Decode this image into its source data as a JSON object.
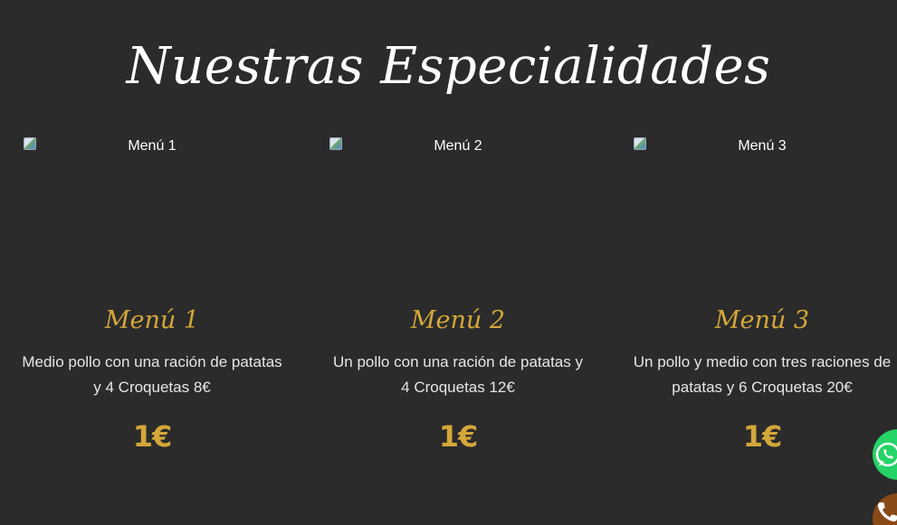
{
  "section": {
    "title": "Nuestras Especialidades"
  },
  "menus": [
    {
      "image_alt": "Menú 1",
      "title": "Menú 1",
      "description": "Medio pollo con una ración de patatas y 4 Croquetas 8€",
      "price": "1€"
    },
    {
      "image_alt": "Menú 2",
      "title": "Menú 2",
      "description": "Un pollo con una ración de patatas y 4 Croquetas 12€",
      "price": "1€"
    },
    {
      "image_alt": "Menú 3",
      "title": "Menú 3",
      "description": "Un pollo y medio con tres raciones de patatas y 6 Croquetas 20€",
      "price": "1€"
    }
  ],
  "floating_buttons": {
    "whatsapp_icon": "whatsapp-icon",
    "phone_icon": "phone-icon",
    "whatsapp_color": "#25d366",
    "phone_color": "#8a4a17"
  },
  "colors": {
    "background": "#2b2b2b",
    "accent": "#d4a73a"
  }
}
